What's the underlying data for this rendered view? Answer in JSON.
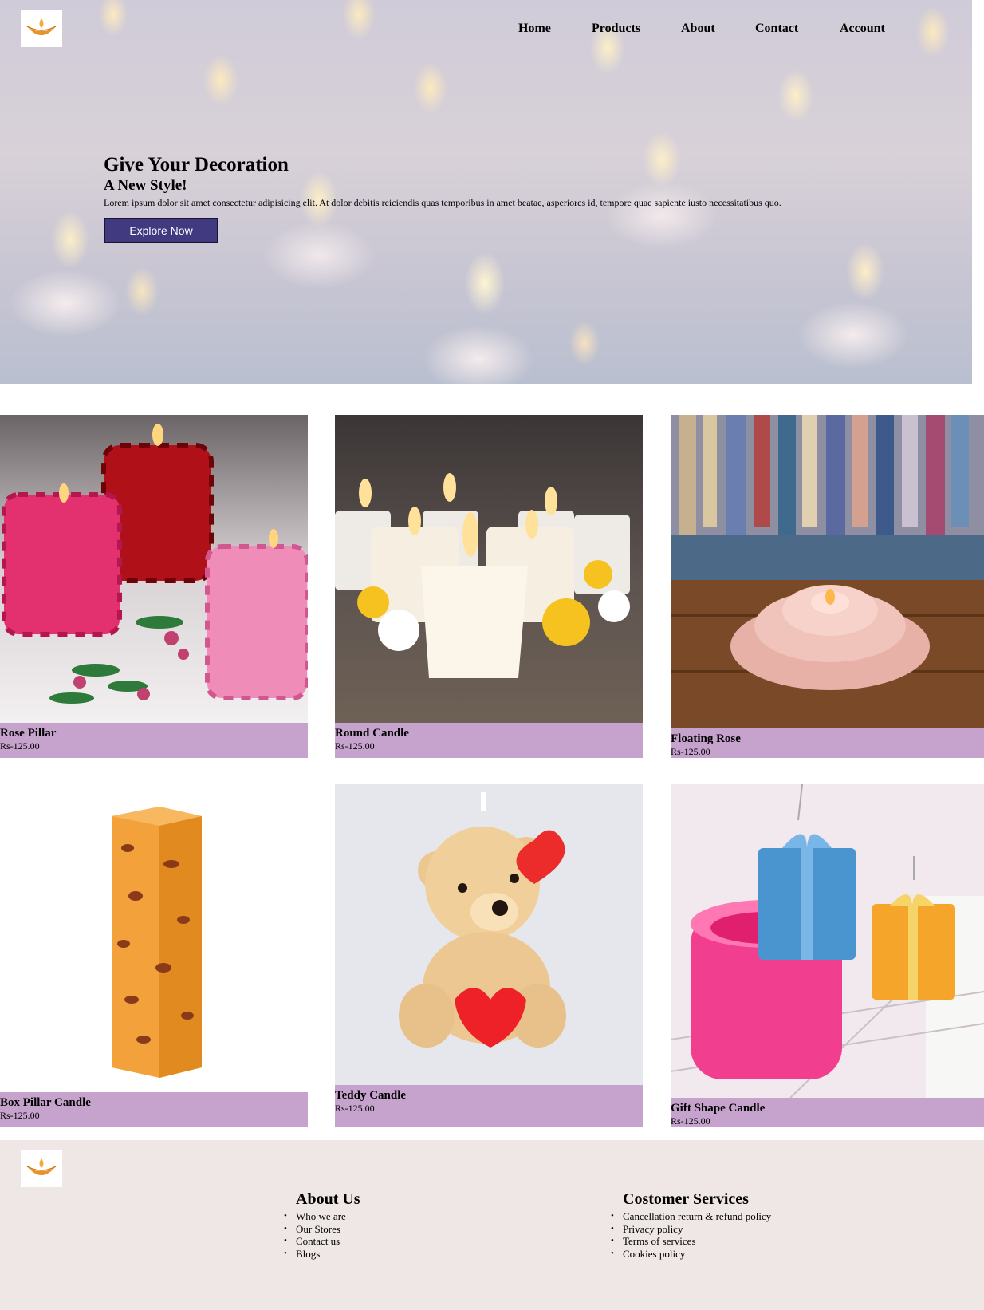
{
  "nav": {
    "items": [
      {
        "label": "Home"
      },
      {
        "label": "Products"
      },
      {
        "label": "About"
      },
      {
        "label": "Contact"
      },
      {
        "label": "Account"
      }
    ]
  },
  "logo": {
    "icon": "diya-lamp-icon",
    "color": "#e8922a"
  },
  "hero": {
    "title": "Give Your Decoration",
    "subtitle": "A New Style!",
    "description": "Lorem ipsum dolor sit amet consectetur adipisicing elit. At dolor debitis reiciendis quas temporibus in amet beatae, asperiores id, tempore quae sapiente iusto necessitatibus quo.",
    "button_label": "Explore Now",
    "button_color": "#423a80"
  },
  "products": [
    {
      "name": "Rose Pillar",
      "price": "Rs-125.00"
    },
    {
      "name": "Round Candle",
      "price": "Rs-125.00"
    },
    {
      "name": "Floating Rose",
      "price": "Rs-125.00"
    },
    {
      "name": "Box Pillar Candle",
      "price": "Rs-125.00"
    },
    {
      "name": "Teddy Candle",
      "price": "Rs-125.00"
    },
    {
      "name": "Gift Shape Candle",
      "price": "Rs-125.00"
    }
  ],
  "caption_color": "#c6a3cd",
  "stray_dot": ".",
  "footer": {
    "about": {
      "heading": "About Us",
      "links": [
        "Who we are",
        "Our Stores",
        "Contact us",
        "Blogs"
      ]
    },
    "services": {
      "heading": "Costomer Services",
      "links": [
        "Cancellation return & refund policy",
        "Privacy policy",
        "Terms of services",
        "Cookies policy"
      ]
    },
    "background": "#efe6e6"
  }
}
